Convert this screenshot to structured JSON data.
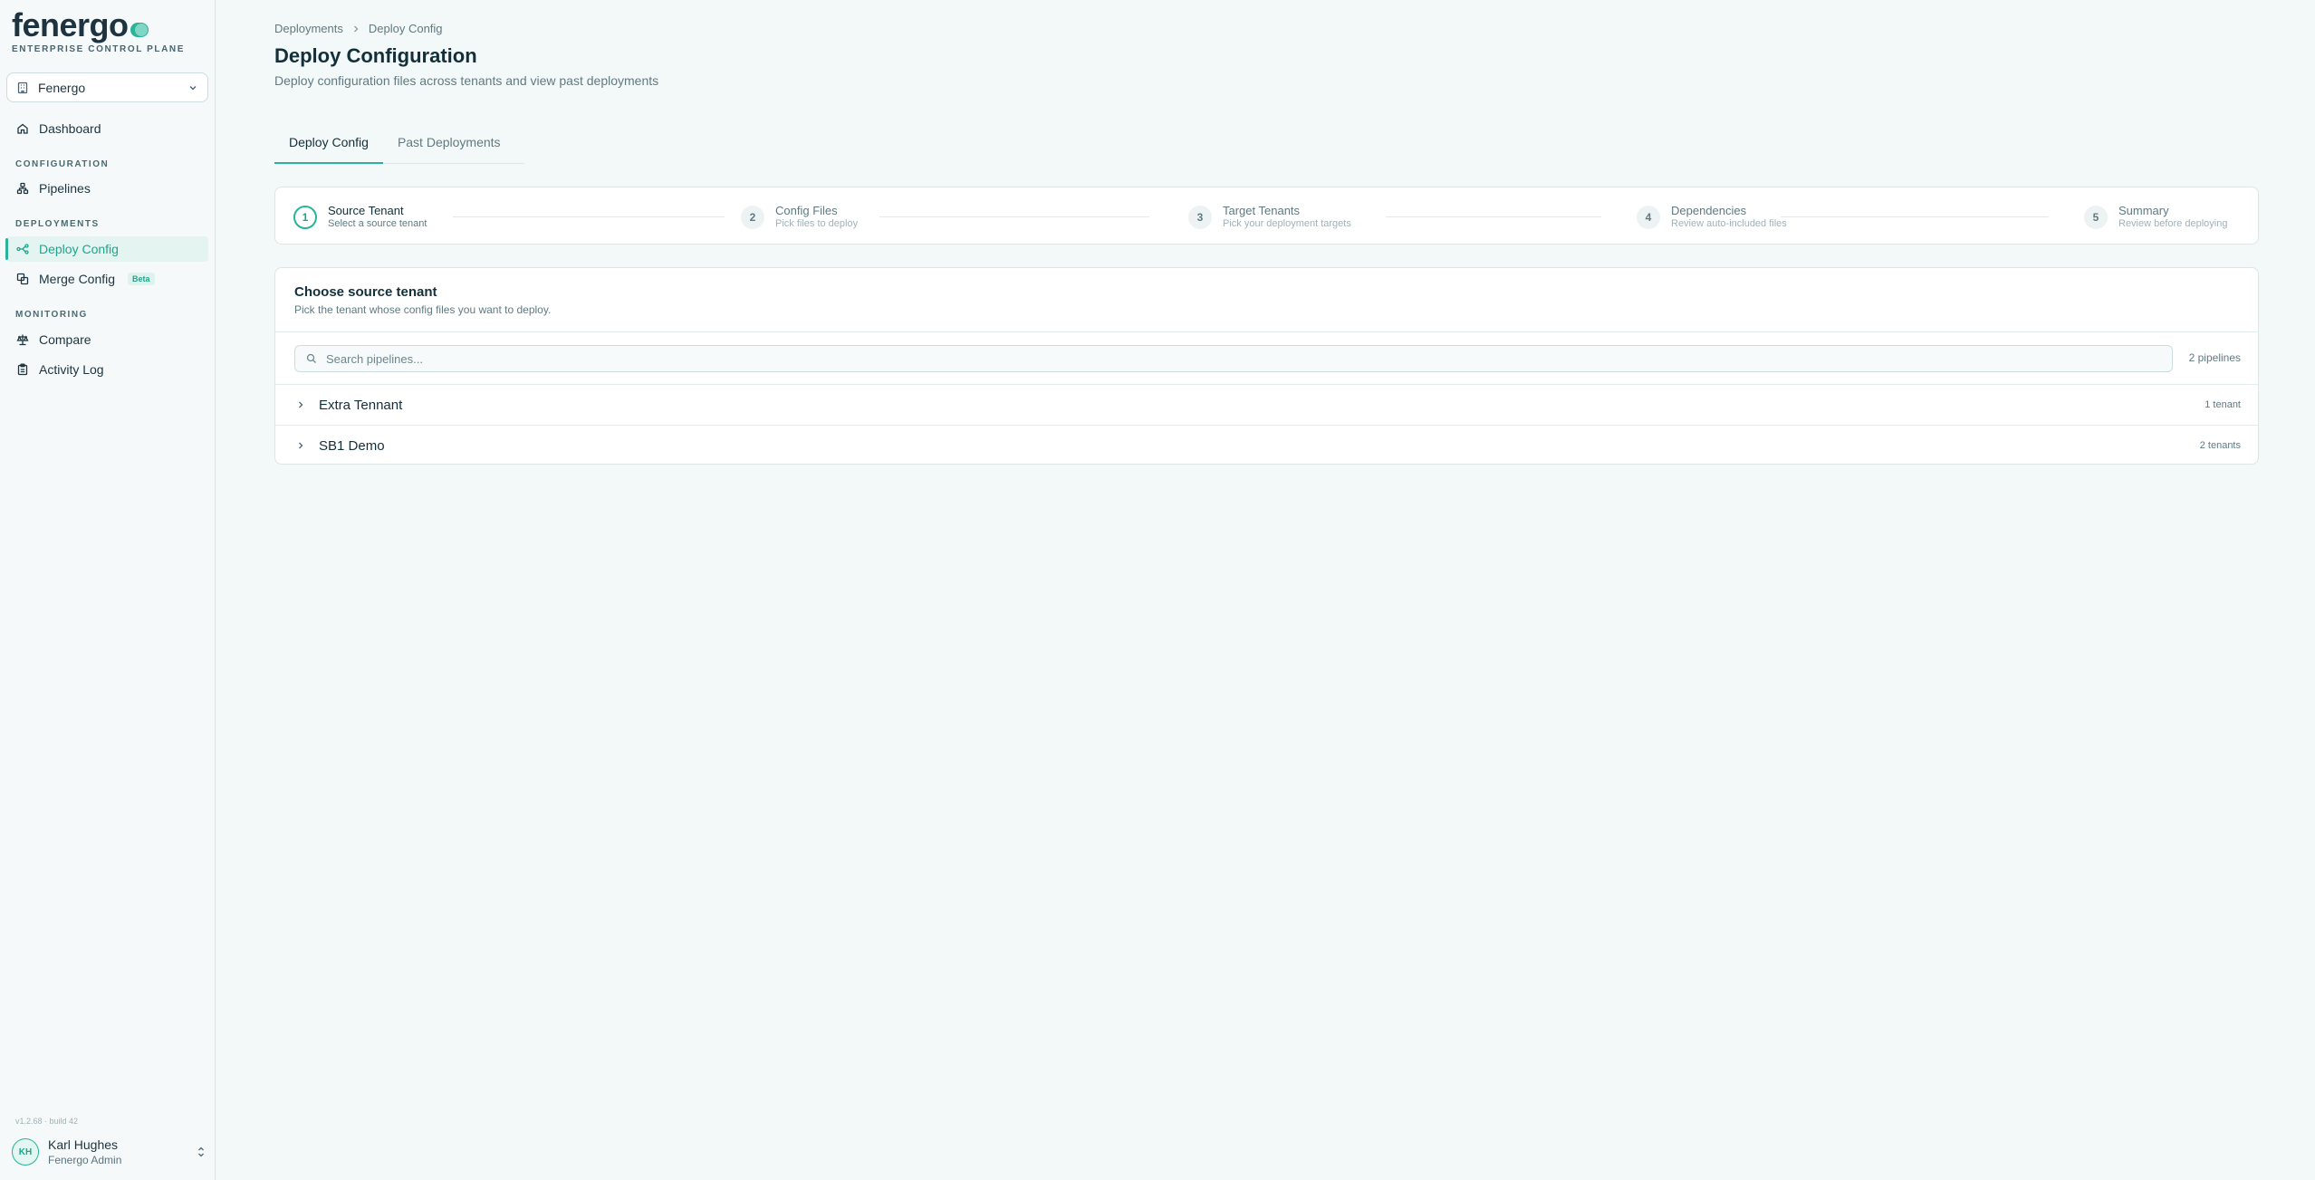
{
  "brand": {
    "logo": "fenergo",
    "tagline": "ENTERPRISE CONTROL PLANE"
  },
  "org_select": {
    "value": "Fenergo"
  },
  "nav": {
    "dashboard": "Dashboard",
    "sections": {
      "configuration": "CONFIGURATION",
      "deployments": "DEPLOYMENTS",
      "monitoring": "MONITORING"
    },
    "pipelines": "Pipelines",
    "deploy_config": "Deploy Config",
    "merge_config": "Merge Config",
    "merge_badge": "Beta",
    "compare": "Compare",
    "activity_log": "Activity Log"
  },
  "footer": {
    "version": "v1.2.68 · build 42",
    "user_initials": "KH",
    "user_name": "Karl Hughes",
    "user_role": "Fenergo Admin"
  },
  "breadcrumb": {
    "parent": "Deployments",
    "current": "Deploy Config"
  },
  "page": {
    "title": "Deploy Configuration",
    "subtitle": "Deploy configuration files across tenants and view past deployments"
  },
  "tabs": [
    {
      "label": "Deploy Config",
      "active": true
    },
    {
      "label": "Past Deployments",
      "active": false
    }
  ],
  "steps": [
    {
      "num": "1",
      "title": "Source Tenant",
      "desc": "Select a source tenant",
      "active": true
    },
    {
      "num": "2",
      "title": "Config Files",
      "desc": "Pick files to deploy",
      "active": false
    },
    {
      "num": "3",
      "title": "Target Tenants",
      "desc": "Pick your deployment targets",
      "active": false
    },
    {
      "num": "4",
      "title": "Dependencies",
      "desc": "Review auto-included files",
      "active": false
    },
    {
      "num": "5",
      "title": "Summary",
      "desc": "Review before deploying",
      "active": false
    }
  ],
  "panel": {
    "title": "Choose source tenant",
    "subtitle": "Pick the tenant whose config files you want to deploy.",
    "search_placeholder": "Search pipelines...",
    "count": "2 pipelines",
    "rows": [
      {
        "name": "Extra Tennant",
        "count": "1 tenant"
      },
      {
        "name": "SB1 Demo",
        "count": "2 tenants"
      }
    ]
  },
  "colors": {
    "accent": "#2bb39a",
    "text": "#13303a",
    "muted": "#5f7a83",
    "background": "#f3f8f8"
  }
}
